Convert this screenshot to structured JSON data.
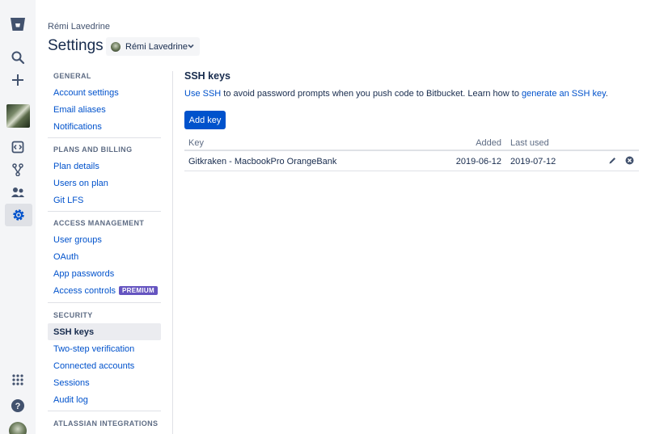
{
  "header": {
    "user_name": "Rémi Lavedrine",
    "page_title": "Settings",
    "account_selector": "Rémi Lavedrine"
  },
  "rail": {
    "icons": [
      "bitbucket-logo-icon",
      "search-icon",
      "create-icon",
      "repositories-icon",
      "pull-requests-icon",
      "teams-icon",
      "settings-icon",
      "app-switcher-icon",
      "help-icon"
    ]
  },
  "nav": {
    "sections": [
      {
        "title": "GENERAL",
        "items": [
          "Account settings",
          "Email aliases",
          "Notifications"
        ]
      },
      {
        "title": "PLANS AND BILLING",
        "items": [
          "Plan details",
          "Users on plan",
          "Git LFS"
        ]
      },
      {
        "title": "ACCESS MANAGEMENT",
        "items": [
          "User groups",
          "OAuth",
          "App passwords",
          "Access controls"
        ]
      },
      {
        "title": "SECURITY",
        "items": [
          "SSH keys",
          "Two-step verification",
          "Connected accounts",
          "Sessions",
          "Audit log"
        ]
      },
      {
        "title": "ATLASSIAN INTEGRATIONS",
        "items": []
      }
    ],
    "premium_badge": "PREMIUM",
    "active_item": "SSH keys"
  },
  "content": {
    "title": "SSH keys",
    "desc_link_1": "Use SSH",
    "desc_text": " to avoid password prompts when you push code to Bitbucket. Learn how to ",
    "desc_link_2": "generate an SSH key",
    "desc_end": ".",
    "add_button": "Add key",
    "table": {
      "headers": {
        "key": "Key",
        "added": "Added",
        "last_used": "Last used"
      },
      "rows": [
        {
          "key": "Gitkraken - MacbookPro OrangeBank",
          "added": "2019-06-12",
          "last_used": "2019-07-12"
        }
      ]
    }
  },
  "colors": {
    "link": "#0052cc",
    "primary_button": "#0052cc",
    "premium": "#6554c0",
    "text": "#172b4d"
  }
}
